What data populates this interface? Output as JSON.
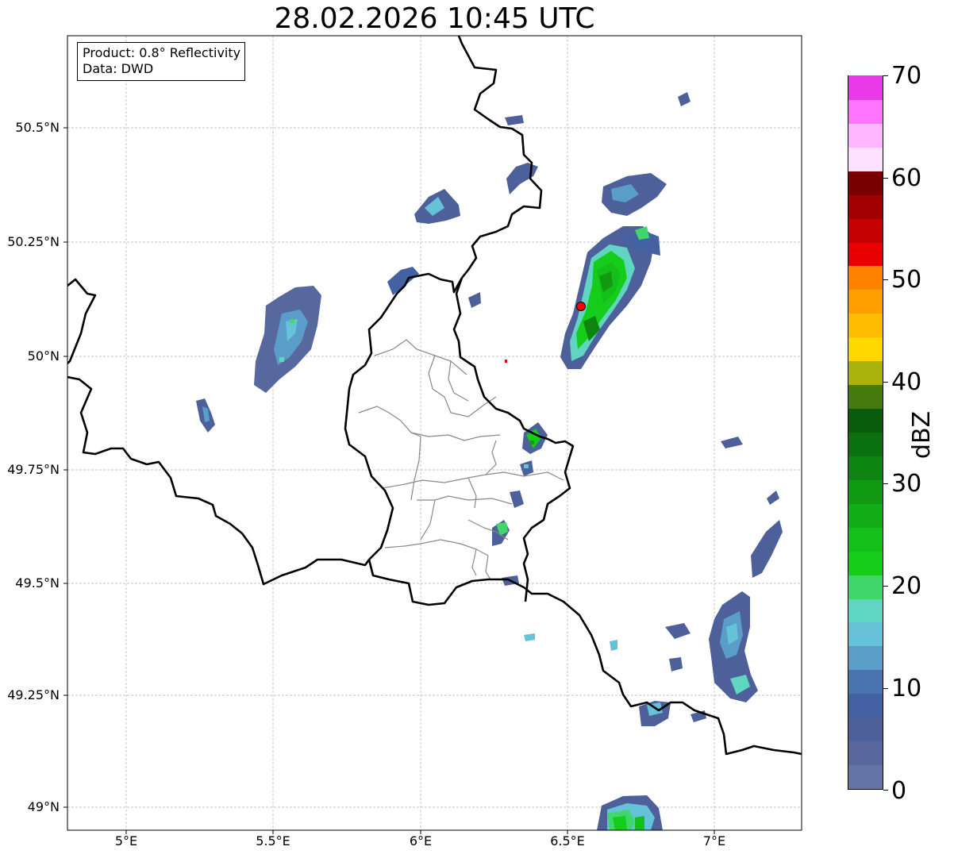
{
  "title": "28.02.2026 10:45 UTC",
  "info": {
    "product": "Product: 0.8° Reflectivity",
    "data": "Data: DWD"
  },
  "axes": {
    "lat_labels": [
      "50.5°N",
      "50.25°N",
      "50°N",
      "49.75°N",
      "49.5°N",
      "49.25°N",
      "49°N"
    ],
    "lon_labels": [
      "5°E",
      "5.5°E",
      "6°E",
      "6.5°E",
      "7°E"
    ],
    "grid": true
  },
  "colorbar": {
    "unit": "dBZ",
    "ticks": [
      "0",
      "10",
      "20",
      "30",
      "40",
      "50",
      "60",
      "70"
    ],
    "colors": [
      "#6474a6",
      "#58689e",
      "#4d6099",
      "#4461a3",
      "#4a74af",
      "#5b9dc9",
      "#66c2d9",
      "#60d6c2",
      "#3fd66c",
      "#15cc1a",
      "#13bf18",
      "#12ad16",
      "#119912",
      "#0e8510",
      "#0b7010",
      "#085c0c",
      "#457a0c",
      "#aab20c",
      "#ffd800",
      "#ffbc00",
      "#ff9f00",
      "#ff8200",
      "#e80000",
      "#c40000",
      "#a00000",
      "#7a0000",
      "#ffe0ff",
      "#ffb5ff",
      "#ff75ff",
      "#e939e9"
    ]
  },
  "chart_data": {
    "type": "heatmap",
    "title": "28.02.2026 10:45 UTC",
    "lon_range": [
      4.8,
      7.3
    ],
    "lat_range": [
      48.95,
      50.7
    ],
    "value_unit": "dBZ",
    "value_range": [
      0,
      70
    ],
    "radar_site": {
      "lon": 6.55,
      "lat": 50.11,
      "color": "#ff0000"
    },
    "echo_cells": [
      {
        "lon": 5.52,
        "lat": 50.05,
        "peak_dbz": 18
      },
      {
        "lon": 5.27,
        "lat": 49.87,
        "peak_dbz": 12
      },
      {
        "lon": 6.05,
        "lat": 50.33,
        "peak_dbz": 15
      },
      {
        "lon": 6.6,
        "lat": 50.15,
        "peak_dbz": 28
      },
      {
        "lon": 6.73,
        "lat": 50.33,
        "peak_dbz": 16
      },
      {
        "lon": 6.37,
        "lat": 49.79,
        "peak_dbz": 22
      },
      {
        "lon": 7.07,
        "lat": 49.37,
        "peak_dbz": 16
      },
      {
        "lon": 6.73,
        "lat": 48.98,
        "peak_dbz": 24
      }
    ]
  }
}
